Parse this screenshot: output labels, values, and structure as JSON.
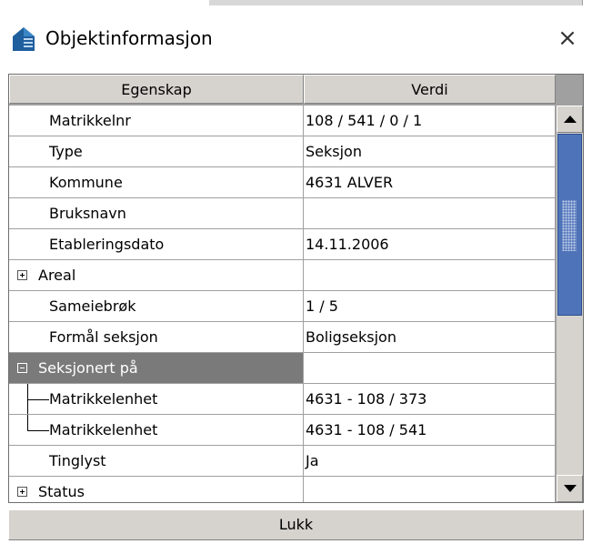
{
  "window": {
    "title": "Objektinformasjon",
    "close_glyph": "×"
  },
  "grid": {
    "column_headers": [
      "Egenskap",
      "Verdi"
    ],
    "rows": [
      {
        "property": "Matrikkelnr",
        "value": "108 / 541 / 0 / 1"
      },
      {
        "property": "Type",
        "value": "Seksjon"
      },
      {
        "property": "Kommune",
        "value": "4631  ALVER"
      },
      {
        "property": "Bruksnavn",
        "value": ""
      },
      {
        "property": "Etableringsdato",
        "value": "14.11.2006"
      },
      {
        "property": "Areal",
        "value": "",
        "expander": "collapsed"
      },
      {
        "property": "Sameiebrøk",
        "value": "1 / 5"
      },
      {
        "property": "Formål seksjon",
        "value": "Boligseksjon"
      },
      {
        "property": "Seksjonert på",
        "value": "",
        "expander": "expanded",
        "selected": true
      },
      {
        "property": "Matrikkelenhet",
        "value": "4631 - 108 / 373",
        "tree": "middle"
      },
      {
        "property": "Matrikkelenhet",
        "value": "4631 - 108 / 541",
        "tree": "last"
      },
      {
        "property": "Tinglyst",
        "value": "Ja"
      },
      {
        "property": "Status",
        "value": "",
        "expander": "collapsed"
      }
    ]
  },
  "footer": {
    "close_button_label": "Lukk"
  },
  "icons": {
    "title_icon": "house-icon",
    "close_icon": "close-icon",
    "scroll_up": "scroll-up-arrow-icon",
    "scroll_down": "scroll-down-arrow-icon"
  },
  "colors": {
    "selection_bg": "#7a7a7a",
    "scroll_thumb": "#4f73b8",
    "header_bg": "#d6d3ce"
  }
}
